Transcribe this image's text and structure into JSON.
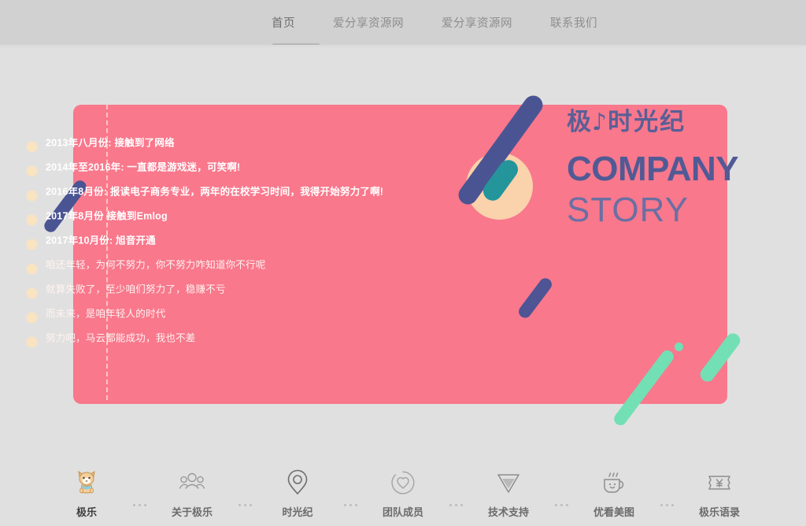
{
  "header": {
    "nav_items": [
      {
        "label": "首页",
        "active": true
      },
      {
        "label": "爱分享资源网",
        "active": false
      },
      {
        "label": "爱分享资源网",
        "active": false
      },
      {
        "label": "联系我们",
        "active": false
      }
    ]
  },
  "brand": {
    "logo_part1": "极",
    "logo_note": "♪",
    "logo_part2": "时光纪",
    "company": "COMPANY",
    "story": "STORY"
  },
  "timeline": {
    "items": [
      {
        "text": "2013年八月份: 接触到了网络",
        "emphasis": "bold"
      },
      {
        "text": "2014年至2016年: 一直都是游戏迷，可笑啊!",
        "emphasis": "bold"
      },
      {
        "text": "2016年8月份: 报读电子商务专业，两年的在校学习时间，我得开始努力了啊!",
        "emphasis": "bold"
      },
      {
        "text": "2017年8月份 接触到Emlog",
        "emphasis": "bold"
      },
      {
        "text": "2017年10月份: 旭音开通",
        "emphasis": "bold"
      },
      {
        "text": "咱还年轻，为何不努力，你不努力咋知道你不行呢",
        "emphasis": "light"
      },
      {
        "text": "就算失败了，至少咱们努力了，稳赚不亏",
        "emphasis": "light"
      },
      {
        "text": "而未来，是咱年轻人的时代",
        "emphasis": "light"
      },
      {
        "text": "努力吧，马云都能成功，我也不差",
        "emphasis": "light"
      }
    ]
  },
  "bottom_nav": {
    "items": [
      {
        "label": "极乐",
        "icon": "shiba-mascot-icon",
        "active": true
      },
      {
        "label": "关于极乐",
        "icon": "people-group-icon",
        "active": false
      },
      {
        "label": "时光纪",
        "icon": "location-pin-icon",
        "active": false
      },
      {
        "label": "团队成员",
        "icon": "heart-circle-icon",
        "active": false
      },
      {
        "label": "技术支持",
        "icon": "funnel-triangle-icon",
        "active": false
      },
      {
        "label": "优看美图",
        "icon": "coffee-cup-smile-icon",
        "active": false
      },
      {
        "label": "极乐语录",
        "icon": "ticket-yen-icon",
        "active": false
      }
    ]
  },
  "colors": {
    "panel_pink": "#f9788c",
    "navy": "#4b5493",
    "teal": "#24959b",
    "peach": "#fad2ab",
    "mint": "#72e0b4",
    "header_grey": "#d1d1d1",
    "body_grey": "#e0e0e0",
    "brand_navy": "#515a95"
  }
}
